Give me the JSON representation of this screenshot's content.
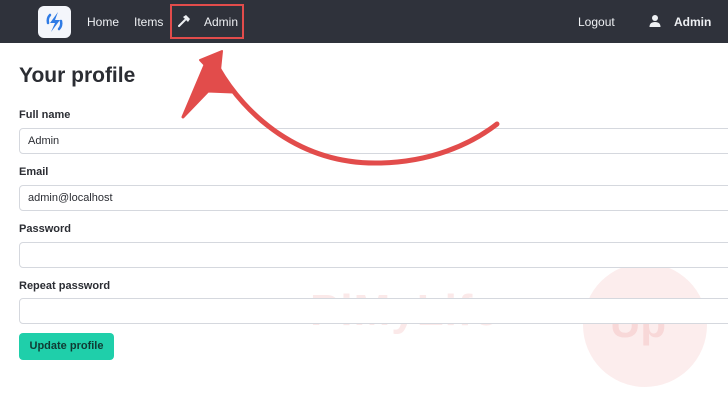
{
  "navbar": {
    "links": {
      "home": "Home",
      "items": "Items",
      "admin": "Admin"
    },
    "logout": "Logout",
    "user": "Admin"
  },
  "page": {
    "title": "Your profile"
  },
  "form": {
    "full_name": {
      "label": "Full name",
      "value": "Admin"
    },
    "email": {
      "label": "Email",
      "value": "admin@localhost"
    },
    "password": {
      "label": "Password",
      "value": ""
    },
    "repeat_password": {
      "label": "Repeat password",
      "value": ""
    },
    "submit_label": "Update profile"
  },
  "watermark": {
    "brand": "PiMyLife",
    "suffix": "Up"
  },
  "annotation_color": "#e24c4b",
  "accent_color": "#1fcfaa"
}
